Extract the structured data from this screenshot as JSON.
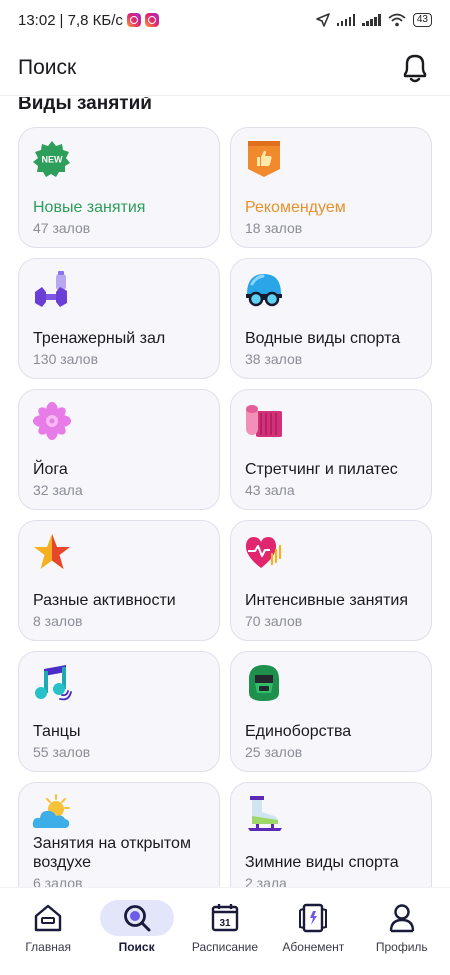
{
  "status_bar": {
    "time": "13:02",
    "speed": "| 7,8 КБ/с",
    "battery": "43"
  },
  "header": {
    "title": "Поиск"
  },
  "section": {
    "title": "Виды занятий"
  },
  "categories": [
    {
      "title": "Новые занятия",
      "count": "47 залов",
      "icon": "new-badge-icon",
      "accent": "#2e9e5b"
    },
    {
      "title": "Рекомендуем",
      "count": "18 залов",
      "icon": "thumbs-up-badge-icon",
      "accent": "#e5922a"
    },
    {
      "title": "Тренажерный зал",
      "count": "130 залов",
      "icon": "dumbbell-icon"
    },
    {
      "title": "Водные виды спорта",
      "count": "38 залов",
      "icon": "swim-cap-goggles-icon"
    },
    {
      "title": "Йога",
      "count": "32 зала",
      "icon": "lotus-icon"
    },
    {
      "title": "Стретчинг и пилатес",
      "count": "43 зала",
      "icon": "yoga-mat-icon"
    },
    {
      "title": "Разные активности",
      "count": "8 залов",
      "icon": "star-icon"
    },
    {
      "title": "Интенсивные занятия",
      "count": "70 залов",
      "icon": "heart-pulse-icon"
    },
    {
      "title": "Танцы",
      "count": "55 залов",
      "icon": "music-note-icon"
    },
    {
      "title": "Единоборства",
      "count": "25 залов",
      "icon": "boxing-helmet-icon"
    },
    {
      "title": "Занятия на открытом воздухе",
      "count": "6 залов",
      "icon": "sun-cloud-icon"
    },
    {
      "title": "Зимние виды спорта",
      "count": "2 зала",
      "icon": "ice-skate-icon"
    }
  ],
  "tabs": [
    {
      "label": "Главная",
      "icon": "home-icon",
      "active": false
    },
    {
      "label": "Поиск",
      "icon": "search-icon",
      "active": true
    },
    {
      "label": "Расписание",
      "icon": "calendar-icon",
      "calendar_day": "31",
      "active": false
    },
    {
      "label": "Абонемент",
      "icon": "membership-card-icon",
      "active": false
    },
    {
      "label": "Профиль",
      "icon": "profile-icon",
      "active": false
    }
  ],
  "colors": {
    "card_bg": "#f6f6fb",
    "active_tab_bg": "#e3e5fb",
    "secondary_text": "#8c8d96"
  }
}
